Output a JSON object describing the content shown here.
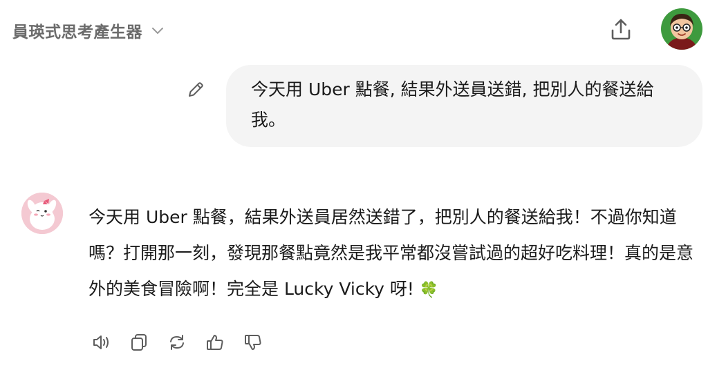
{
  "header": {
    "title": "員瑛式思考產生器",
    "chevron_icon": "chevron-down-icon",
    "share_icon": "share-icon"
  },
  "user": {
    "avatar_icon": "user-avatar-icon",
    "edit_icon": "pencil-icon",
    "message": "今天用 Uber 點餐, 結果外送員送錯, 把別人的餐送給我。"
  },
  "assistant": {
    "avatar_icon": "assistant-avatar-icon",
    "message_text": "今天用 Uber 點餐，結果外送員居然送錯了，把別人的餐送給我！不過你知道嗎？打開那一刻，發現那餐點竟然是我平常都沒嘗試過的超好吃料理！真的是意外的美食冒險啊！完全是 Lucky Vicky 呀!",
    "message_emoji": "🍀",
    "actions": [
      "read-aloud-icon",
      "copy-icon",
      "regenerate-icon",
      "thumbs-up-icon",
      "thumbs-down-icon"
    ]
  },
  "colors": {
    "bubble_bg": "#f4f4f4",
    "muted_text": "#6b6b6b",
    "icon_gray": "#5d5d5d"
  }
}
